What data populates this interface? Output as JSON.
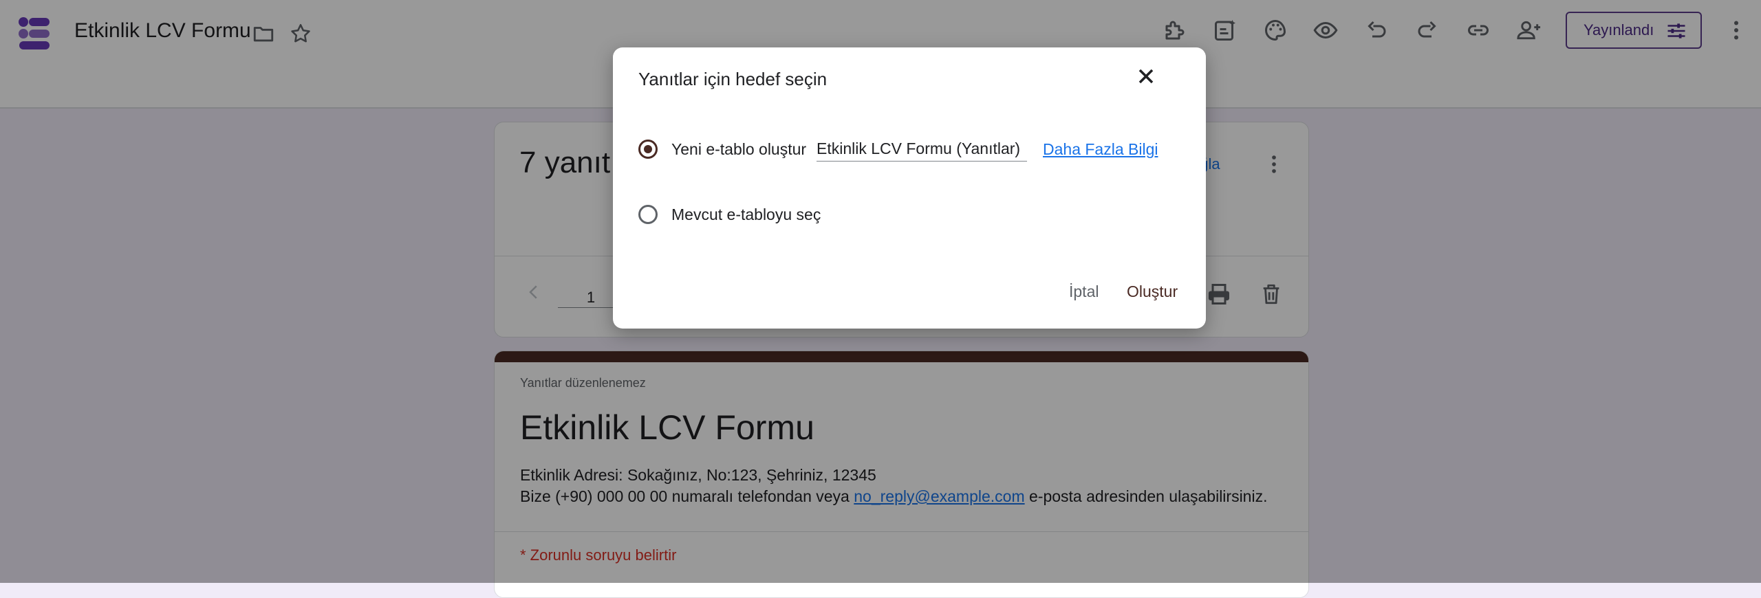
{
  "header": {
    "title": "Etkinlik LCV Formu",
    "publish_label": "Yayınlandı",
    "icons": [
      "forms-logo",
      "folder-icon",
      "star-icon",
      "addon-icon",
      "ai-suggest-icon",
      "palette-icon",
      "preview-eye-icon",
      "undo-icon",
      "redo-icon",
      "link-icon",
      "add-collaborator-icon",
      "more-vert-icon"
    ]
  },
  "responses_card": {
    "title": "7 yanıt",
    "link_partial": "ağla",
    "page_number": "1"
  },
  "form_card": {
    "note": "Yanıtlar düzenlenemez",
    "title": "Etkinlik LCV Formu",
    "address_line": "Etkinlik Adresi: Sokağınız, No:123, Şehriniz, 12345",
    "contact_prefix": "Bize (+90) 000 00 00 numaralı telefondan veya ",
    "contact_email": "no_reply@example.com",
    "contact_suffix": " e-posta adresinden ulaşabilirsiniz.",
    "required_note": "* Zorunlu soruyu belirtir"
  },
  "dialog": {
    "title": "Yanıtlar için hedef seçin",
    "option_new_label": "Yeni e-tablo oluştur",
    "option_new_selected": true,
    "new_sheet_name": "Etkinlik LCV Formu (Yanıtlar)",
    "learn_more": "Daha Fazla Bilgi",
    "option_existing_label": "Mevcut e-tabloyu seç",
    "option_existing_selected": false,
    "cancel_label": "İptal",
    "create_label": "Oluştur"
  },
  "colors": {
    "accent": "#4a2a24",
    "brand": "#673ab7",
    "link": "#1a73e8",
    "required": "#d93025"
  }
}
